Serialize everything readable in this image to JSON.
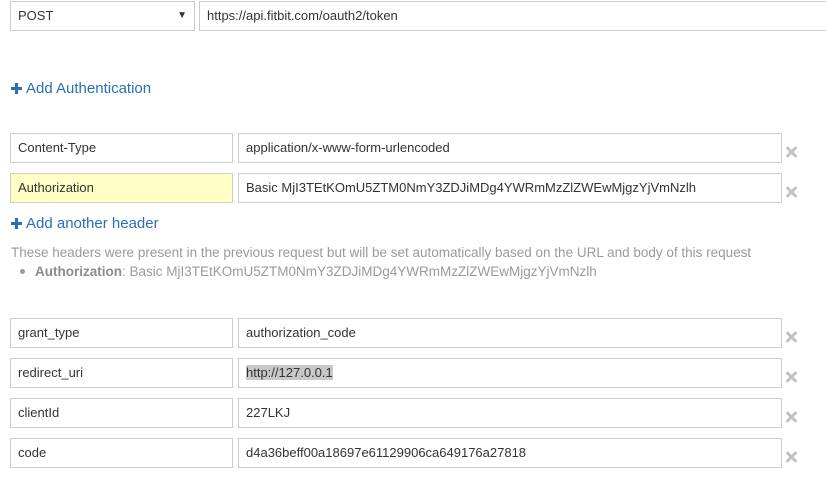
{
  "request": {
    "method": "POST",
    "url": "https://api.fitbit.com/oauth2/token"
  },
  "add_authentication_label": "Add Authentication",
  "headers": [
    {
      "name": "Content-Type",
      "value": "application/x-www-form-urlencoded"
    },
    {
      "name": "Authorization",
      "value": "Basic MjI3TEtKOmU5ZTM0NmY3ZDJiMDg4YWRmMzZlZWEwMjgzYjVmNzlh"
    }
  ],
  "add_header_label": "Add another header",
  "previous_headers_note": "These headers were present in the previous request but will be set automatically based on the URL and body of this request",
  "previous_headers": [
    {
      "name": "Authorization",
      "value": ": Basic MjI3TEtKOmU5ZTM0NmY3ZDJiMDg4YWRmMzZlZWEwMjgzYjVmNzlh"
    }
  ],
  "body_params": [
    {
      "name": "grant_type",
      "value": "authorization_code"
    },
    {
      "name": "redirect_uri",
      "value": "http://127.0.0.1"
    },
    {
      "name": "clientId",
      "value": "227LKJ"
    },
    {
      "name": "code",
      "value": "d4a36beff00a18697e61129906ca649176a27818"
    }
  ],
  "colors": {
    "link": "#2a6fb8",
    "highlight": "#ffffc5",
    "border": "#cccccc",
    "muted_text": "#9a9a9a"
  },
  "icons": {
    "remove": "close-icon",
    "add": "plus-icon",
    "method_dropdown": "caret-down-icon"
  }
}
